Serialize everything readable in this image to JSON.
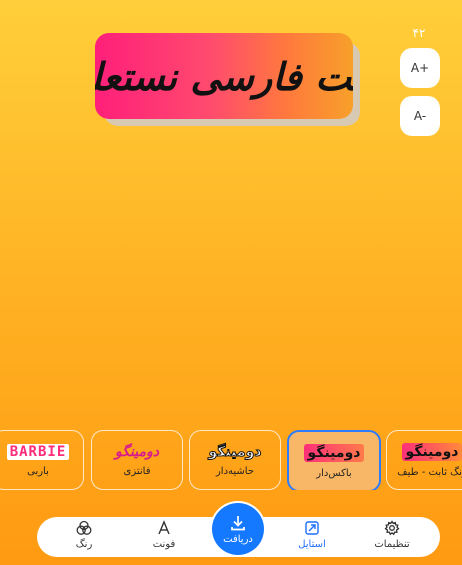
{
  "preview": {
    "text": "فونت فارسی نستعلیق"
  },
  "size_control": {
    "value": "۴۲",
    "increase_label": "A+",
    "decrease_label": "A-"
  },
  "styles": [
    {
      "sample": "BARBIE",
      "label": "باربی"
    },
    {
      "sample": "دومینگو",
      "label": "فانتزی"
    },
    {
      "sample": "دومینگو",
      "label": "حاشیه‌دار"
    },
    {
      "sample": "دومینگو",
      "label": "باکس‌دار"
    },
    {
      "sample": "دومینگو",
      "label": "رنگ ثابت - طیف"
    }
  ],
  "selected_style": "باکس‌دار",
  "nav": {
    "color_label": "رنگ",
    "font_label": "فونت",
    "download_label": "دریافت",
    "style_label": "استایل",
    "settings_label": "تنظیمات"
  },
  "colors": {
    "accent": "#1479ff",
    "active_nav": "#1e6fff"
  }
}
